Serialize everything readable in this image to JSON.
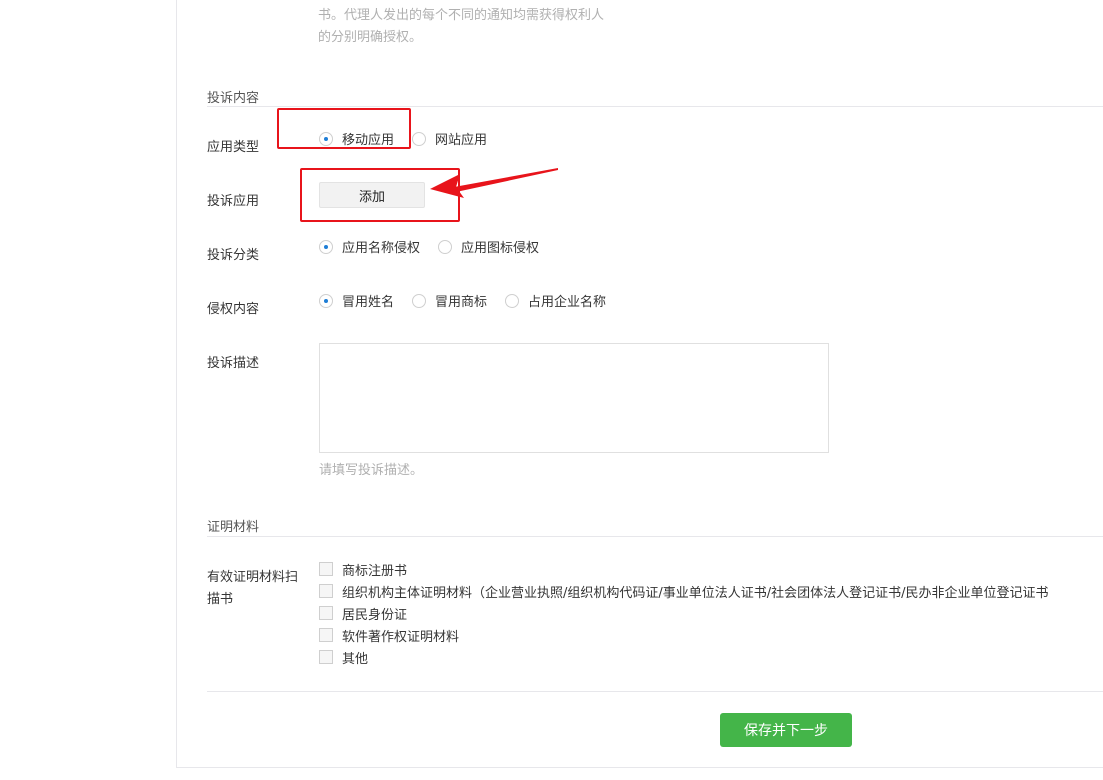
{
  "notice": {
    "line1": "书。代理人发出的每个不同的通知均需获得权利人",
    "line2": "的分别明确授权。"
  },
  "complaint_section": {
    "title": "投诉内容",
    "app_type": {
      "label": "应用类型",
      "options": [
        "移动应用",
        "网站应用"
      ],
      "selected": "移动应用"
    },
    "complaint_app": {
      "label": "投诉应用",
      "button": "添加"
    },
    "category": {
      "label": "投诉分类",
      "options": [
        "应用名称侵权",
        "应用图标侵权"
      ],
      "selected": "应用名称侵权"
    },
    "infringement": {
      "label": "侵权内容",
      "options": [
        "冒用姓名",
        "冒用商标",
        "占用企业名称"
      ],
      "selected": "冒用姓名"
    },
    "description": {
      "label": "投诉描述",
      "value": "",
      "hint": "请填写投诉描述。"
    }
  },
  "evidence_section": {
    "title": "证明材料",
    "scan_label_line1": "有效证明材料扫",
    "scan_label_line2": "描书",
    "items": [
      "商标注册书",
      "组织机构主体证明材料（企业营业执照/组织机构代码证/事业单位法人证书/社会团体法人登记证书/民办非企业单位登记证书",
      "居民身份证",
      "软件著作权证明材料",
      "其他"
    ]
  },
  "footer": {
    "save_button": "保存并下一步"
  },
  "annotation": {
    "color": "#e8141b"
  }
}
